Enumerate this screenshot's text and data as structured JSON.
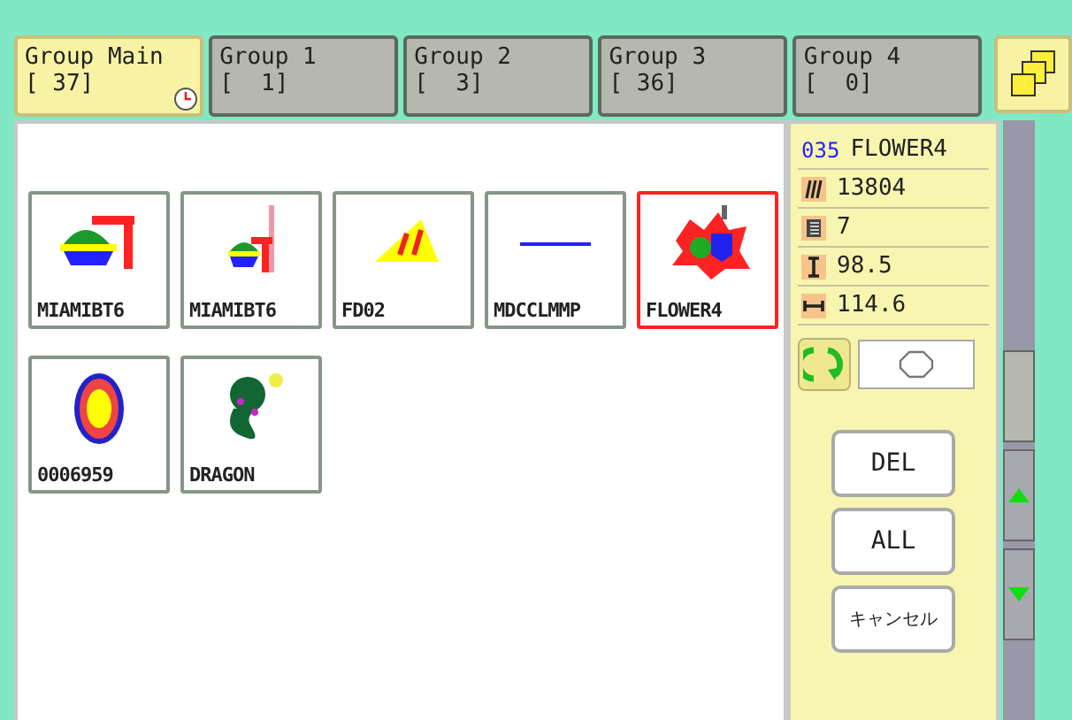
{
  "tabs": [
    {
      "label": "Group Main",
      "count": "[ 37]",
      "selected": true,
      "clock": true
    },
    {
      "label": "Group 1",
      "count": "[  1]",
      "selected": false,
      "clock": false
    },
    {
      "label": "Group 2",
      "count": "[  3]",
      "selected": false,
      "clock": false
    },
    {
      "label": "Group 3",
      "count": "[ 36]",
      "selected": false,
      "clock": false
    },
    {
      "label": "Group 4",
      "count": "[  0]",
      "selected": false,
      "clock": false
    }
  ],
  "designs": [
    {
      "name": "MIAMIBT6",
      "kind": "boat",
      "selected": false
    },
    {
      "name": "MIAMIBT6",
      "kind": "boat-small",
      "selected": false
    },
    {
      "name": "FD02",
      "kind": "wedge",
      "selected": false
    },
    {
      "name": "MDCCLMMP",
      "kind": "line",
      "selected": false
    },
    {
      "name": "FLOWER4",
      "kind": "flower",
      "selected": true
    },
    {
      "name": "0006959",
      "kind": "oval",
      "selected": false
    },
    {
      "name": "DRAGON",
      "kind": "dragon",
      "selected": false
    }
  ],
  "info": {
    "number": "035",
    "name": "FLOWER4",
    "rows": [
      {
        "kind": "stitches",
        "value": "13804"
      },
      {
        "kind": "colors",
        "value": "7"
      },
      {
        "kind": "height",
        "value": "98.5"
      },
      {
        "kind": "width",
        "value": "114.6"
      }
    ]
  },
  "buttons": [
    "DEL",
    "ALL",
    "キャンセル"
  ]
}
